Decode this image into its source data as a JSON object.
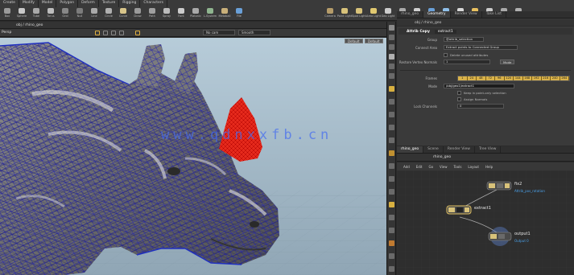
{
  "shelf": {
    "tabs": [
      "Create",
      "Modify",
      "Model",
      "Polygon",
      "Deform",
      "Texture",
      "Rigging",
      "Characters"
    ],
    "tools": [
      {
        "label": "Box",
        "color": "#9a9a9a"
      },
      {
        "label": "Sphere",
        "color": "#c9c9c9"
      },
      {
        "label": "Tube",
        "color": "#a8a8a8"
      },
      {
        "label": "Torus",
        "color": "#bdbdbd"
      },
      {
        "label": "Grid",
        "color": "#888888"
      },
      {
        "label": "Null",
        "color": "#7c7c7c"
      },
      {
        "label": "Line",
        "color": "#aaaaaa"
      },
      {
        "label": "Circle",
        "color": "#b0b0b0"
      },
      {
        "label": "Curve",
        "color": "#d8c58a"
      },
      {
        "label": "Draw",
        "color": "#9a9a9a"
      },
      {
        "label": "Path",
        "color": "#a0a0a0"
      },
      {
        "label": "Spray",
        "color": "#bbbbbb"
      },
      {
        "label": "Font",
        "color": "#cccccc"
      },
      {
        "label": "Platonic",
        "color": "#aaaaaa"
      },
      {
        "label": "L-System",
        "color": "#8fb58f"
      },
      {
        "label": "Metaball",
        "color": "#c9b07a"
      },
      {
        "label": "File",
        "color": "#6aa0d8"
      }
    ],
    "tools_right": [
      {
        "label": "Camera",
        "color": "#b59c6a"
      },
      {
        "label": "Point Light",
        "color": "#d8c27a"
      },
      {
        "label": "Spot Light",
        "color": "#d8c27a"
      },
      {
        "label": "Area Light",
        "color": "#e0c870"
      },
      {
        "label": "Geo Light",
        "color": "#cccccc"
      },
      {
        "label": "Volume",
        "color": "#aaaaaa"
      },
      {
        "label": "Distant",
        "color": "#cfcfcf"
      },
      {
        "label": "Env Light",
        "color": "#6aa0d8"
      },
      {
        "label": "Sky Light",
        "color": "#8fbfe8"
      },
      {
        "label": "GI Light",
        "color": "#d8d8d8"
      },
      {
        "label": "Caustic",
        "color": "#e8c060"
      },
      {
        "label": "Portal",
        "color": "#cccccc"
      },
      {
        "label": "Ambient",
        "color": "#aaaaaa"
      },
      {
        "label": "Stereo",
        "color": "#b0b0b0"
      }
    ]
  },
  "viewport": {
    "path": "obj / rhino_geo",
    "label": "Persp",
    "camera_menu": "No cam",
    "display_menu": "Smooth",
    "ref_buttons": [
      "Default",
      "Default"
    ],
    "watermark": "www.qdnxxfb.cn"
  },
  "right_panel": {
    "tabs": [
      "rhino_geo",
      "Geometry",
      "Render View",
      "Take List"
    ],
    "path": "obj / rhino_geo",
    "node_type": "Attrib Copy",
    "node_name": "extract1",
    "params": [
      {
        "label": "Group",
        "value": "@attrib_selection"
      },
      {
        "label": "Connect Area",
        "value": "Extract points to Connected Group"
      },
      {
        "label": "Restore Vertex Normals",
        "value": "1"
      }
    ],
    "checkbox_1": "Delete unused attributes",
    "frames_label": "Frames",
    "frames": [
      "1",
      "24",
      "48",
      "72",
      "96",
      "120",
      "144",
      "168",
      "192",
      "216",
      "240",
      "264"
    ],
    "rows": [
      {
        "label": "Mode",
        "value": "/obj/geo1/extract1"
      }
    ],
    "checkboxes": [
      "Keep in point-only selection",
      "Assign Normals"
    ],
    "last_label": "Lock Channels",
    "last_value": "0",
    "mode_btn": "Mode"
  },
  "network": {
    "tabs": [
      "rhino_geo",
      "Scene",
      "Render View",
      "Tree View"
    ],
    "path": "rhino_geo",
    "menu": [
      "Add",
      "Edit",
      "Go",
      "View",
      "Tools",
      "Layout",
      "Help"
    ],
    "nodes": [
      {
        "name": "fix2",
        "sub": "Attrib_pos_rotation"
      },
      {
        "name": "extract1",
        "sub": ""
      },
      {
        "name": "output1",
        "sub": "Output 0"
      }
    ]
  }
}
